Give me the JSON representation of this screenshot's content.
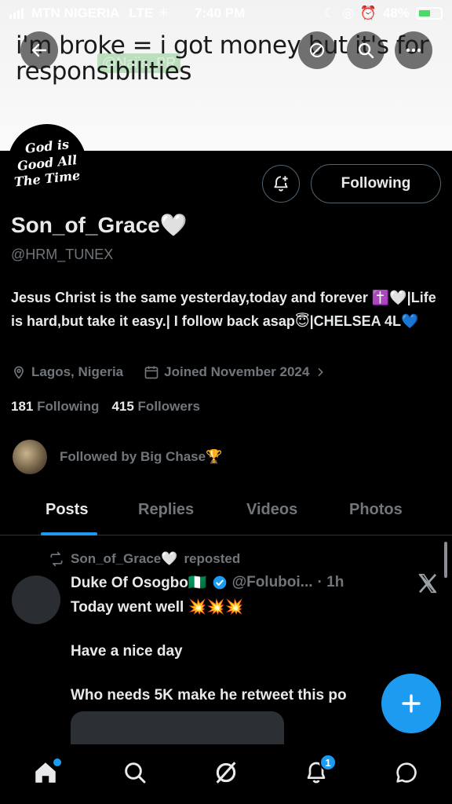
{
  "status_bar": {
    "carrier": "MTN NIGERIA",
    "network": "LTE",
    "time": "7:40 PM",
    "battery": "48%"
  },
  "banner": {
    "text": "i'm broke = i got money but it's for responsibilities",
    "watermark": "@Naija_PR"
  },
  "avatar": {
    "lines": [
      "God is",
      "Good All",
      "The Time"
    ]
  },
  "actions": {
    "following_label": "Following"
  },
  "profile": {
    "name": "Son_of_Grace🤍",
    "handle": "@HRM_TUNEX",
    "bio": "Jesus Christ is the same yesterday,today and forever ✝️🤍|Life is hard,but take it easy.| I follow back asap😇|CHELSEA 4L💙",
    "location": "Lagos, Nigeria",
    "joined": "Joined November 2024",
    "following_count": "181",
    "following_label": "Following",
    "followers_count": "415",
    "followers_label": "Followers",
    "followed_by": "Followed by Big Chase🏆"
  },
  "tabs": [
    {
      "label": "Posts"
    },
    {
      "label": "Replies"
    },
    {
      "label": "Videos"
    },
    {
      "label": "Photos"
    }
  ],
  "post": {
    "repost_by": "Son_of_Grace🤍",
    "repost_suffix": "reposted",
    "author": "Duke Of Osogbo🇳🇬",
    "author_handle": "@Foluboi...",
    "time": "· 1h",
    "lines": [
      "Today went well 💥💥💥",
      "Have a nice day",
      "Who needs 5K make he retweet this po"
    ]
  },
  "nav": {
    "notifications_badge": "1"
  },
  "colors": {
    "accent": "#1d9bf0",
    "background": "#000000",
    "muted": "#71767b"
  },
  "icons": [
    "back-arrow-icon",
    "mute-icon",
    "search-icon",
    "more-icon",
    "notification-bell-plus-icon",
    "location-icon",
    "calendar-icon",
    "chevron-right-icon",
    "repost-icon",
    "verified-icon",
    "x-logo-icon",
    "plus-icon",
    "home-icon",
    "search-nav-icon",
    "grok-icon",
    "bell-icon",
    "messages-icon"
  ]
}
